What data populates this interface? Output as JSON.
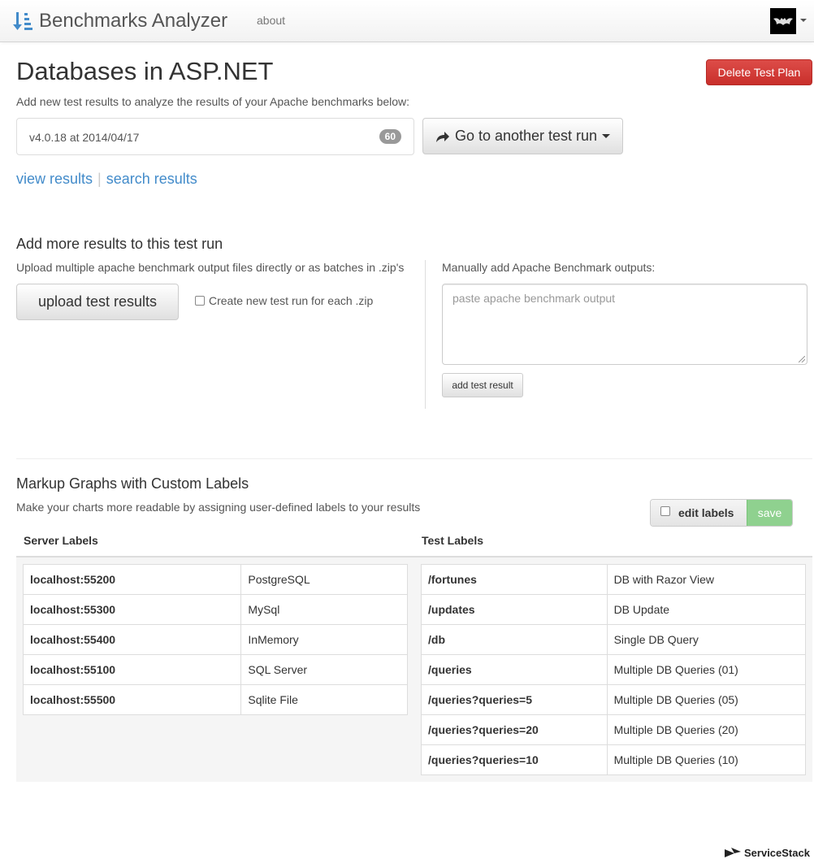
{
  "navbar": {
    "brand": "Benchmarks Analyzer",
    "about": "about"
  },
  "page": {
    "title": "Databases in ASP.NET",
    "delete_button": "Delete Test Plan",
    "intro": "Add new test results to analyze the results of your Apache benchmarks below:"
  },
  "test_run": {
    "label": "v4.0.18 at 2014/04/17",
    "count": "60",
    "goto_button": "Go to another test run"
  },
  "links": {
    "view": "view results",
    "separator": "|",
    "search": "search results"
  },
  "add_results": {
    "title": "Add more results to this test run",
    "upload_help": "Upload multiple apache benchmark output files directly or as batches in .zip's",
    "upload_button": "upload test results",
    "zip_checkbox": "Create new test run for each .zip",
    "manual_label": "Manually add Apache Benchmark outputs:",
    "manual_placeholder": "paste apache benchmark output",
    "add_button": "add test result"
  },
  "markup": {
    "title": "Markup Graphs with Custom Labels",
    "help": "Make your charts more readable by assigning user-defined labels to your results",
    "edit_labels": "edit labels",
    "save": "save",
    "server_header": "Server Labels",
    "test_header": "Test Labels",
    "server_labels": [
      {
        "key": "localhost:55200",
        "value": "PostgreSQL"
      },
      {
        "key": "localhost:55300",
        "value": "MySql"
      },
      {
        "key": "localhost:55400",
        "value": "InMemory"
      },
      {
        "key": "localhost:55100",
        "value": "SQL Server"
      },
      {
        "key": "localhost:55500",
        "value": "Sqlite File"
      }
    ],
    "test_labels": [
      {
        "key": "/fortunes",
        "value": "DB with Razor View"
      },
      {
        "key": "/updates",
        "value": "DB Update"
      },
      {
        "key": "/db",
        "value": "Single DB Query"
      },
      {
        "key": "/queries",
        "value": "Multiple DB Queries (01)"
      },
      {
        "key": "/queries?queries=5",
        "value": "Multiple DB Queries (05)"
      },
      {
        "key": "/queries?queries=20",
        "value": "Multiple DB Queries (20)"
      },
      {
        "key": "/queries?queries=10",
        "value": "Multiple DB Queries (10)"
      }
    ]
  },
  "footer": {
    "logo_text": "ServiceStack"
  },
  "colors": {
    "link": "#428bca",
    "danger": "#d9534f",
    "success": "#8fd18f"
  }
}
